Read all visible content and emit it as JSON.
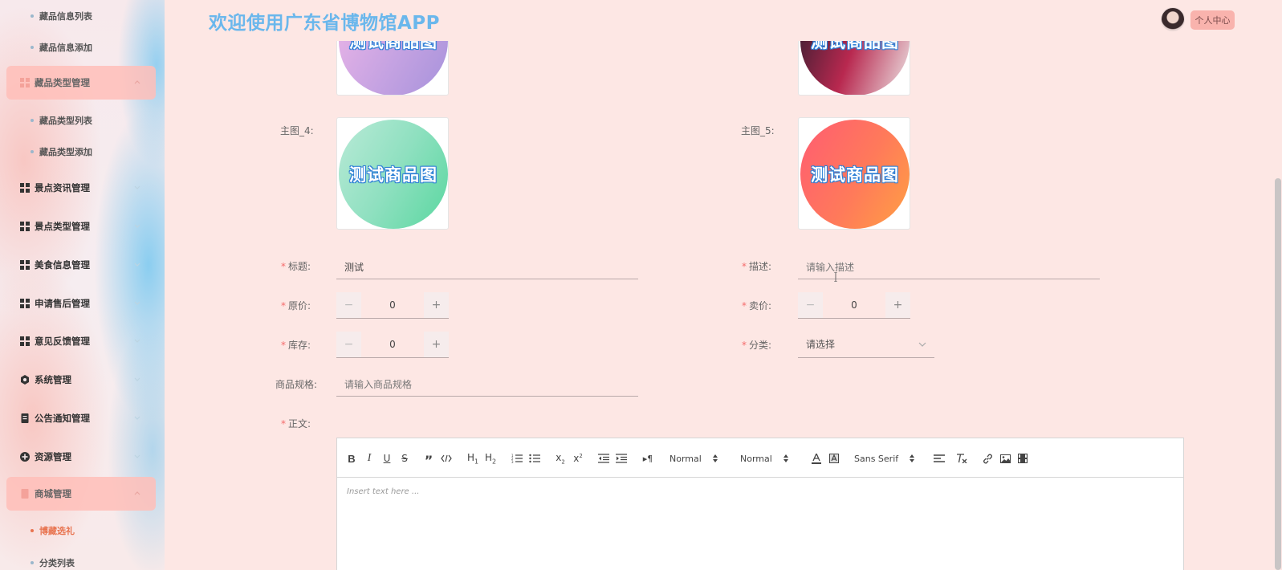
{
  "header": {
    "title": "欢迎使用广东省博物馆APP",
    "user_center": "个人中心"
  },
  "sidebar": {
    "items": [
      {
        "type": "sub",
        "label": "藏品信息列表"
      },
      {
        "type": "sub",
        "label": "藏品信息添加"
      },
      {
        "type": "group",
        "label": "藏品类型管理",
        "open": true
      },
      {
        "type": "sub",
        "label": "藏品类型列表"
      },
      {
        "type": "sub",
        "label": "藏品类型添加"
      },
      {
        "type": "group",
        "label": "景点资讯管理"
      },
      {
        "type": "group",
        "label": "景点类型管理"
      },
      {
        "type": "group",
        "label": "美食信息管理"
      },
      {
        "type": "group",
        "label": "申请售后管理"
      },
      {
        "type": "group",
        "label": "意见反馈管理"
      },
      {
        "type": "group",
        "label": "系统管理"
      },
      {
        "type": "group",
        "label": "公告通知管理"
      },
      {
        "type": "group",
        "label": "资源管理"
      },
      {
        "type": "group",
        "label": "商城管理",
        "open": true
      },
      {
        "type": "sub",
        "label": "博藏选礼",
        "active": true
      },
      {
        "type": "sub",
        "label": "分类列表"
      }
    ]
  },
  "form": {
    "image_text": "测试商品图",
    "main_image_4_label": "主图_4:",
    "main_image_5_label": "主图_5:",
    "title_label": "标题:",
    "title_value": "测试",
    "desc_label": "描述:",
    "desc_placeholder": "请输入描述",
    "original_price_label": "原价:",
    "original_price_value": "0",
    "sale_price_label": "卖价:",
    "sale_price_value": "0",
    "stock_label": "库存:",
    "stock_value": "0",
    "category_label": "分类:",
    "category_placeholder": "请选择",
    "spec_label": "商品规格:",
    "spec_placeholder": "请输入商品规格",
    "body_label": "正文:",
    "required_mark": "*",
    "minus": "−",
    "plus": "+"
  },
  "editor": {
    "header_select": "Normal",
    "size_select": "Normal",
    "font_select": "Sans Serif",
    "placeholder": "Insert text here ..."
  },
  "colors": {
    "title_blue": "#6ab7ec",
    "required_red": "#f56c6c",
    "active_orange": "#e8734f",
    "page_bg": "#fde7e4"
  }
}
